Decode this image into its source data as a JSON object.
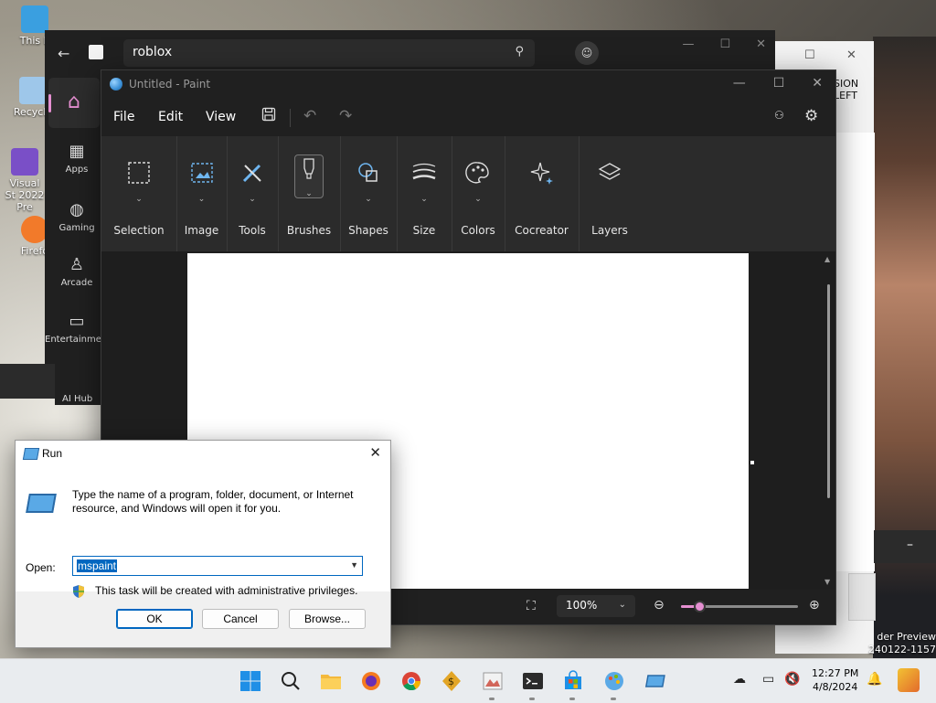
{
  "desktop": {
    "icons": [
      {
        "label": "This P",
        "color": "#3a9fe0"
      },
      {
        "label": "Recycle",
        "color": "#9ec7ea"
      },
      {
        "label": "Visual St 2022 Pre",
        "color": "#7a4fc7"
      },
      {
        "label": "Firefo",
        "color": "#f27a2a"
      }
    ],
    "corner_text": [
      "der Preview",
      "240122-1157"
    ]
  },
  "background_window": {
    "text": [
      "SION",
      "LEFT"
    ],
    "dash": "–"
  },
  "store": {
    "search_value": "roblox",
    "nav": [
      {
        "label": "Apps",
        "icon": "apps-icon"
      },
      {
        "label": "Gaming",
        "icon": "gamepad-icon"
      },
      {
        "label": "Arcade",
        "icon": "arcade-icon"
      },
      {
        "label": "Entertainment",
        "icon": "clapper-icon"
      },
      {
        "label": "AI Hub",
        "icon": "ai-icon"
      }
    ]
  },
  "paint": {
    "window_title": "Untitled - Paint",
    "menu": {
      "file": "File",
      "edit": "Edit",
      "view": "View"
    },
    "ribbon": [
      {
        "label": "Selection",
        "icon": "selection-icon"
      },
      {
        "label": "Image",
        "icon": "image-icon"
      },
      {
        "label": "Tools",
        "icon": "tools-icon"
      },
      {
        "label": "Brushes",
        "icon": "brush-icon"
      },
      {
        "label": "Shapes",
        "icon": "shapes-icon"
      },
      {
        "label": "Size",
        "icon": "size-icon"
      },
      {
        "label": "Colors",
        "icon": "palette-icon"
      },
      {
        "label": "Cocreator",
        "icon": "sparkle-icon"
      },
      {
        "label": "Layers",
        "icon": "layers-icon"
      }
    ],
    "zoom": {
      "value": "100%",
      "slider_fraction": 0.16
    },
    "colors": {
      "accent": "#e58fd1",
      "background": "#202020",
      "ribbon": "#2b2b2b"
    }
  },
  "run_dialog": {
    "title": "Run",
    "description": "Type the name of a program, folder, document, or Internet resource, and Windows will open it for you.",
    "open_label": "Open:",
    "open_value": "mspaint",
    "privileges": "This task will be created with administrative privileges.",
    "buttons": {
      "ok": "OK",
      "cancel": "Cancel",
      "browse": "Browse..."
    }
  },
  "taskbar": {
    "clock_time": "12:27 PM",
    "clock_date": "4/8/2024"
  }
}
